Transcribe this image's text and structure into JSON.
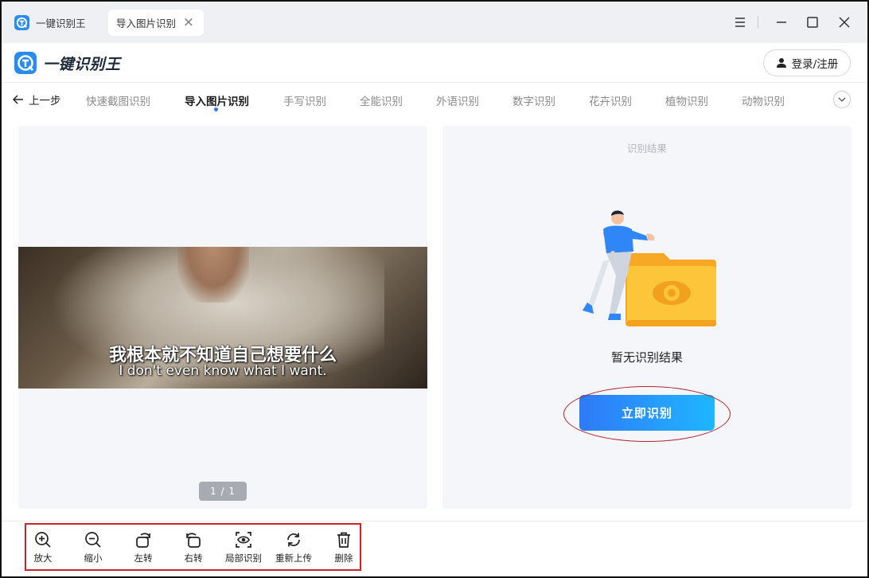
{
  "tabs": {
    "home_label": "一键识别王",
    "active_label": "导入图片识别",
    "close_glyph": "×"
  },
  "header": {
    "brand": "一键识别王",
    "login_label": "登录/注册"
  },
  "nav": {
    "back_label": "上一步",
    "items": [
      "快速截图识别",
      "导入图片识别",
      "手写识别",
      "全能识别",
      "外语识别",
      "数字识别",
      "花卉识别",
      "植物识别",
      "动物识别"
    ],
    "active_index": 1
  },
  "preview": {
    "subtitle_cn": "我根本就不知道自己想要什么",
    "subtitle_en": "I don't even know what I want.",
    "pager": "1 / 1"
  },
  "result": {
    "title": "识别结果",
    "empty_text": "暂无识别结果",
    "action_label": "立即识别"
  },
  "toolbar": {
    "items": [
      {
        "label": "放大",
        "icon": "zoom-in-icon"
      },
      {
        "label": "缩小",
        "icon": "zoom-out-icon"
      },
      {
        "label": "左转",
        "icon": "rotate-left-icon"
      },
      {
        "label": "右转",
        "icon": "rotate-right-icon"
      },
      {
        "label": "局部识别",
        "icon": "eye-scan-icon"
      },
      {
        "label": "重新上传",
        "icon": "refresh-icon"
      },
      {
        "label": "删除",
        "icon": "trash-icon"
      }
    ]
  },
  "colors": {
    "accent": "#2b7df5",
    "button_gradient_start": "#2f7af8",
    "button_gradient_end": "#1fb6ff",
    "annotation_red": "#c8242b"
  }
}
